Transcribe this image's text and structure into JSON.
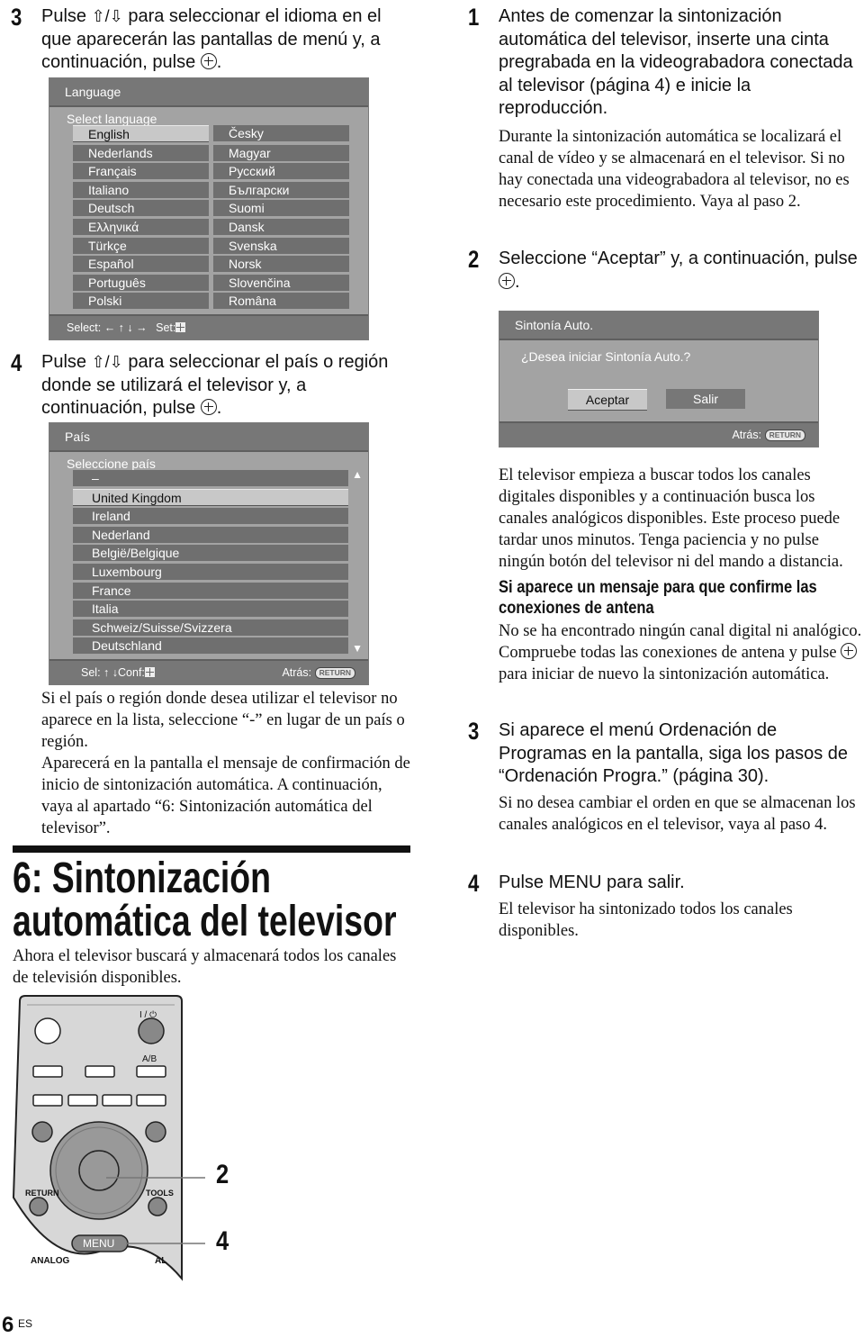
{
  "left_column": {
    "step3": {
      "number": "3",
      "text_before": "Pulse ",
      "arrows": "⇧/⇩",
      "text_after": " para seleccionar el idioma en el que aparecerán las pantallas de menú y, a continuación, pulse ",
      "end": "."
    },
    "language_screen": {
      "title": "Language",
      "subtitle": "Select language",
      "selected": "English",
      "items_left": [
        "English",
        "Nederlands",
        "Français",
        "Italiano",
        "Deutsch",
        "Ελληνικά",
        "Türkçe",
        "Español",
        "Português",
        "Polski"
      ],
      "items_right": [
        "Česky",
        "Magyar",
        "Русский",
        "Български",
        "Suomi",
        "Dansk",
        "Svenska",
        "Norsk",
        "Slovenčina",
        "Româna"
      ],
      "footer_select": "Select:",
      "footer_arrows": "← ↑ ↓ →",
      "footer_set": "Set:"
    },
    "step4": {
      "number": "4",
      "text_before": "Pulse ",
      "arrows": "⇧/⇩",
      "text_after": " para seleccionar el país o región donde se utilizará el televisor y, a continuación, pulse ",
      "end": "."
    },
    "country_screen": {
      "title": "País",
      "subtitle": "Seleccione país",
      "selected": "United Kingdom",
      "items": [
        "–",
        "United Kingdom",
        "Ireland",
        "Nederland",
        "België/Belgique",
        "Luxembourg",
        "France",
        "Italia",
        "Schweiz/Suisse/Svizzera",
        "Deutschland"
      ],
      "footer_sel": "Sel:",
      "footer_arrows": "↑ ↓",
      "footer_conf": "Conf:",
      "footer_back": "Atrás:",
      "return_badge": "RETURN"
    },
    "note_country": "Si el país o región donde desea utilizar el televisor no aparece en la lista, seleccione “-” en lugar de un país o región.",
    "note_confirm": "Aparecerá en la pantalla el mensaje de confirmación de inicio de sintonización automática. A continuación, vaya al apartado “6: Sintonización automática del televisor”.",
    "section_title_line1": "6: Sintonización",
    "section_title_line2": "automática del televisor",
    "section_intro": "Ahora el televisor buscará y almacenará todos los canales de televisión disponibles."
  },
  "remote": {
    "labels": {
      "power": "I / ⏻",
      "ab": "A/B",
      "return": "RETURN",
      "tools": "TOOLS",
      "menu": "MENU",
      "analog": "ANALOG",
      "digital_partial": "AL"
    },
    "callouts": [
      "2",
      "4"
    ]
  },
  "right_column": {
    "step1": {
      "number": "1",
      "text": "Antes de comenzar la sintonización automática del televisor, inserte una cinta pregrabada en la videograbadora conectada al televisor (página 4) e inicie la reproducción.",
      "note": "Durante la sintonización automática se localizará el canal de vídeo y se almacenará en el televisor. Si no hay conectada una videograbadora al televisor, no es necesario este procedimiento. Vaya al paso 2."
    },
    "step2": {
      "number": "2",
      "text_before": "Seleccione “Aceptar” y, a continuación, pulse ",
      "end": "."
    },
    "autotune_screen": {
      "title": "Sintonía Auto.",
      "question": "¿Desea iniciar Sintonía Auto.?",
      "accept_label": "Aceptar",
      "exit_label": "Salir",
      "selected": "Aceptar",
      "footer_back": "Atrás:",
      "return_badge": "RETURN"
    },
    "note_search": "El televisor empieza a buscar todos los canales digitales disponibles y a continuación busca los canales analógicos disponibles. Este proceso puede tardar unos minutos. Tenga paciencia y no pulse ningún botón del televisor ni del mando a distancia.",
    "subhead_line1": "Si aparece un mensaje para que confirme las",
    "subhead_line2": "conexiones de antena",
    "note_antenna_before": "No se ha encontrado ningún canal digital ni analógico. Compruebe todas las conexiones de antena y pulse ",
    "note_antenna_after": " para iniciar de nuevo la sintonización automática.",
    "step3": {
      "number": "3",
      "text": "Si aparece el menú Ordenación de Programas en la pantalla, siga los pasos de “Ordenación Progra.” (página 30).",
      "note": "Si no desea cambiar el orden en que se almacenan los canales analógicos en el televisor, vaya al paso 4."
    },
    "step4": {
      "number": "4",
      "text": "Pulse MENU para salir.",
      "note": "El televisor ha sintonizado todos los canales disponibles."
    }
  },
  "footer": {
    "page_number": "6",
    "language_code": "ES"
  }
}
